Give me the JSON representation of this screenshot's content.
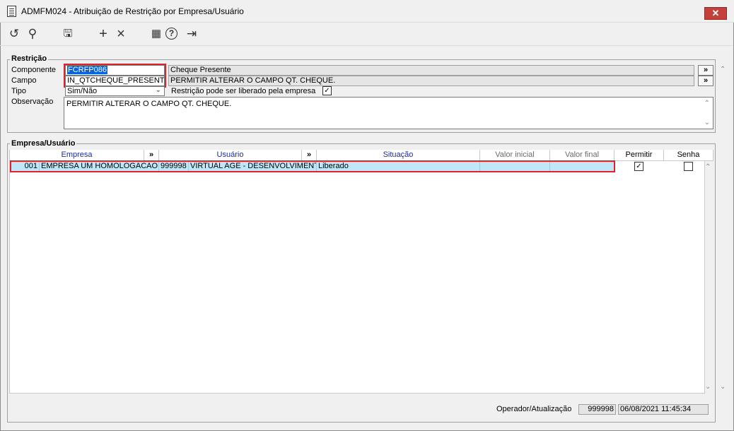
{
  "window": {
    "title": "ADMFM024 - Atribuição de Restrição por Empresa/Usuário",
    "close_label": "✕"
  },
  "toolbar": [
    {
      "name": "undo-button",
      "icon": "↺"
    },
    {
      "name": "search-button",
      "icon": "⚲"
    },
    {
      "name": "save-button",
      "icon": "🖫"
    },
    {
      "name": "add-button",
      "icon": "+"
    },
    {
      "name": "delete-button",
      "icon": "×"
    },
    {
      "name": "calendar-button",
      "icon": "▦"
    },
    {
      "name": "help-button",
      "icon": "?"
    },
    {
      "name": "exit-button",
      "icon": "⇥"
    }
  ],
  "restricao": {
    "group_title": "Restrição",
    "componente_label": "Componente",
    "componente_value": "FCRFP086",
    "componente_desc": "Cheque Presente",
    "campo_label": "Campo",
    "campo_value": "IN_QTCHEQUE_PRESENTE",
    "campo_desc": "PERMITIR ALTERAR O CAMPO QT. CHEQUE.",
    "tipo_label": "Tipo",
    "tipo_value": "Sim/Não",
    "liberado_label": "Restrição pode ser liberado pela empresa",
    "liberado_checked": "✓",
    "observacao_label": "Observação",
    "observacao_value": "PERMITIR ALTERAR O CAMPO QT. CHEQUE.",
    "lookup_symbol": "»"
  },
  "empresa_usuario": {
    "group_title": "Empresa/Usuário",
    "columns": {
      "empresa": "Empresa",
      "usuario": "Usuário",
      "situacao": "Situação",
      "valor_inicial": "Valor inicial",
      "valor_final": "Valor final",
      "permitir": "Permitir",
      "senha": "Senha",
      "expand": "»"
    },
    "rows": [
      {
        "empresa_code": "001",
        "empresa_name": "EMPRESA UM HOMOLOGACAO",
        "usuario_code": "999998",
        "usuario_name": "VIRTUAL AGE - DESENVOLVIMENTO",
        "situacao": "Liberado",
        "valor_inicial": "",
        "valor_final": "",
        "permitir": "✓",
        "senha": ""
      }
    ]
  },
  "status": {
    "label": "Operador/Atualização",
    "operator": "999998",
    "datetime": "06/08/2021 11:45:34"
  }
}
